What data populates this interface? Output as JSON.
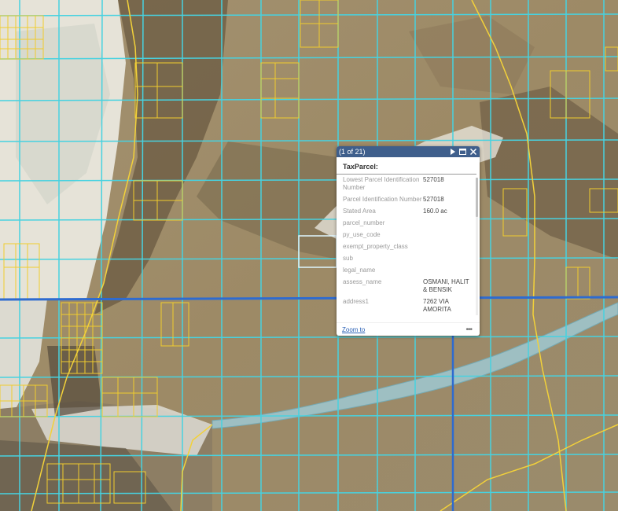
{
  "map": {
    "basemap": "satellite-imagery",
    "colors": {
      "grid_line": "#47d2e0",
      "parcel_line": "#f0cc2e",
      "road": "#f2d13a",
      "boundary": "#2e6bd0",
      "river": "#9fc9d2"
    }
  },
  "popup": {
    "count_label": "(1 of 21)",
    "title": "TaxParcel:",
    "header_color": "#3f5f8c",
    "icons": [
      "play-icon",
      "maximize-icon",
      "close-icon"
    ],
    "attributes": [
      {
        "label": "Lowest Parcel Identification Number",
        "value": "527018"
      },
      {
        "label": "Parcel Identification Number",
        "value": "527018"
      },
      {
        "label": "Stated Area",
        "value": "160.0 ac"
      },
      {
        "label": "parcel_number",
        "value": ""
      },
      {
        "label": "py_use_code",
        "value": ""
      },
      {
        "label": "exempt_property_class",
        "value": ""
      },
      {
        "label": "sub",
        "value": ""
      },
      {
        "label": "legal_name",
        "value": ""
      },
      {
        "label": "assess_name",
        "value": "OSMANI, HALIT & BENSIK"
      },
      {
        "label": "address1",
        "value": "7262 VIA AMORITA"
      }
    ],
    "zoom_label": "Zoom to",
    "more_label": "•••"
  }
}
